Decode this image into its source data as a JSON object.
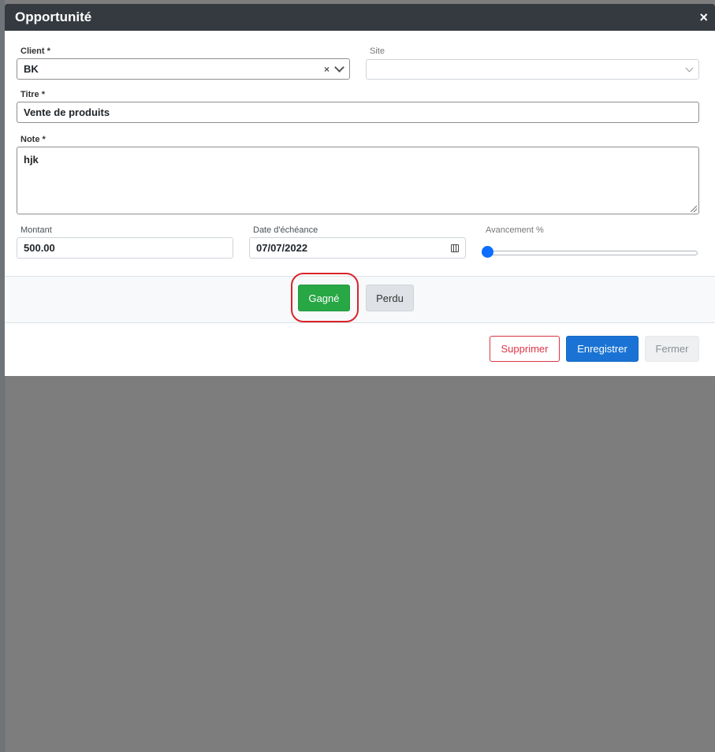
{
  "modal": {
    "title": "Opportunité",
    "close_glyph": "×"
  },
  "form": {
    "client": {
      "label": "Client *",
      "value": "BK",
      "clear_glyph": "×"
    },
    "site": {
      "label": "Site",
      "value": ""
    },
    "title": {
      "label": "Titre *",
      "value": "Vente de produits"
    },
    "note": {
      "label": "Note *",
      "value": "hjk"
    },
    "amount": {
      "label": "Montant",
      "value": "500.00"
    },
    "due_date": {
      "label": "Date d'échéance",
      "value": "07/07/2022"
    },
    "progress": {
      "label": "Avancement %",
      "value": 0
    }
  },
  "status_buttons": {
    "won_label": "Gagné",
    "lost_label": "Perdu"
  },
  "footer": {
    "delete_label": "Supprimer",
    "save_label": "Enregistrer",
    "close_label": "Fermer"
  },
  "colors": {
    "header_bg": "#343a40",
    "won": "#28a745",
    "save": "#1a73d4",
    "delete": "#dc3545",
    "slider": "#0d6efd",
    "highlight": "#d9232a"
  },
  "icons": {
    "close": "close-icon",
    "chevron": "chevron-down-icon",
    "calendar": "calendar-icon",
    "resize": "resize-grip-icon"
  }
}
